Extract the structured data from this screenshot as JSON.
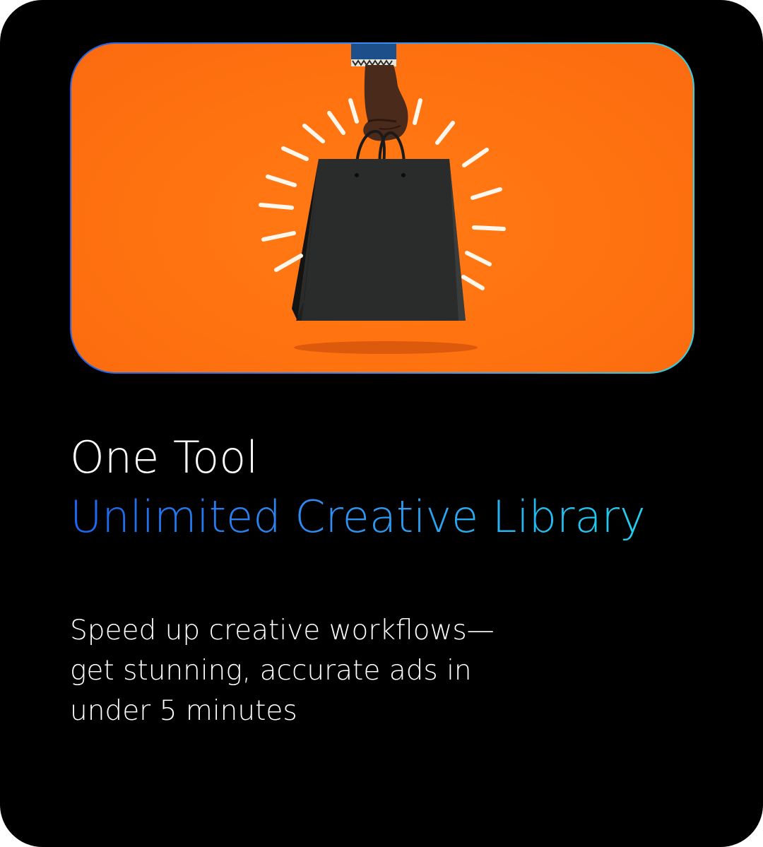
{
  "hero": {
    "image": "shopping-bag-photo",
    "background_color": "#ff7410",
    "frame_gradient": [
      "#1f63e6",
      "#2ad6e8"
    ]
  },
  "headline": {
    "line1": "One Tool",
    "line2": "Unlimited Creative Library",
    "line2_gradient": [
      "#1c66f0",
      "#20d0ee"
    ]
  },
  "description": {
    "lines": [
      "Speed up creative workflows—",
      "get stunning, accurate ads in",
      "under 5 minutes"
    ]
  }
}
